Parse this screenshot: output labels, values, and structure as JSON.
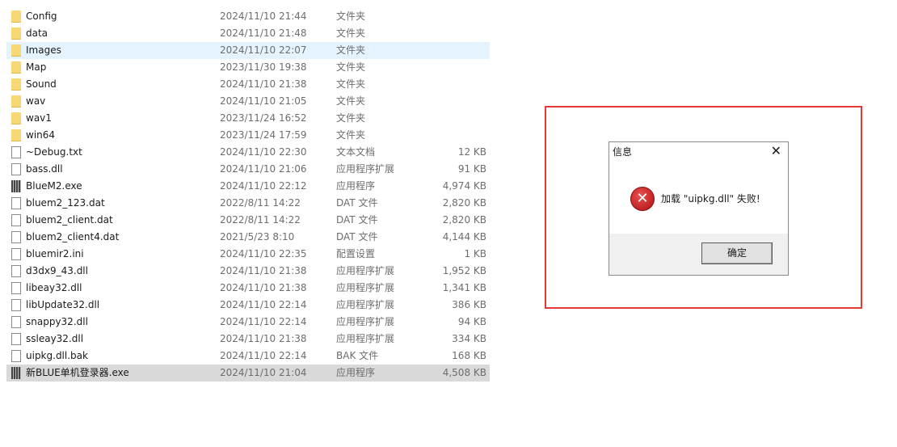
{
  "files": [
    {
      "name": "Config",
      "date": "2024/11/10 21:44",
      "type": "文件夹",
      "size": "",
      "icon": "folder-icon"
    },
    {
      "name": "data",
      "date": "2024/11/10 21:48",
      "type": "文件夹",
      "size": "",
      "icon": "folder-icon"
    },
    {
      "name": "Images",
      "date": "2024/11/10 22:07",
      "type": "文件夹",
      "size": "",
      "icon": "folder-icon",
      "state": "hover"
    },
    {
      "name": "Map",
      "date": "2023/11/30 19:38",
      "type": "文件夹",
      "size": "",
      "icon": "folder-icon"
    },
    {
      "name": "Sound",
      "date": "2024/11/10 21:38",
      "type": "文件夹",
      "size": "",
      "icon": "folder-icon"
    },
    {
      "name": "wav",
      "date": "2024/11/10 21:05",
      "type": "文件夹",
      "size": "",
      "icon": "folder-icon"
    },
    {
      "name": "wav1",
      "date": "2023/11/24 16:52",
      "type": "文件夹",
      "size": "",
      "icon": "folder-icon"
    },
    {
      "name": "win64",
      "date": "2023/11/24 17:59",
      "type": "文件夹",
      "size": "",
      "icon": "folder-icon"
    },
    {
      "name": "~Debug.txt",
      "date": "2024/11/10 22:30",
      "type": "文本文档",
      "size": "12 KB",
      "icon": "text-file-icon"
    },
    {
      "name": "bass.dll",
      "date": "2024/11/10 21:06",
      "type": "应用程序扩展",
      "size": "91 KB",
      "icon": "dll-file-icon"
    },
    {
      "name": "BlueM2.exe",
      "date": "2024/11/10 22:12",
      "type": "应用程序",
      "size": "4,974 KB",
      "icon": "exe-icon"
    },
    {
      "name": "bluem2_123.dat",
      "date": "2022/8/11 14:22",
      "type": "DAT 文件",
      "size": "2,820 KB",
      "icon": "file-icon"
    },
    {
      "name": "bluem2_client.dat",
      "date": "2022/8/11 14:22",
      "type": "DAT 文件",
      "size": "2,820 KB",
      "icon": "file-icon"
    },
    {
      "name": "bluem2_client4.dat",
      "date": "2021/5/23 8:10",
      "type": "DAT 文件",
      "size": "4,144 KB",
      "icon": "file-icon"
    },
    {
      "name": "bluemir2.ini",
      "date": "2024/11/10 22:35",
      "type": "配置设置",
      "size": "1 KB",
      "icon": "ini-file-icon"
    },
    {
      "name": "d3dx9_43.dll",
      "date": "2024/11/10 21:38",
      "type": "应用程序扩展",
      "size": "1,952 KB",
      "icon": "dll-file-icon"
    },
    {
      "name": "libeay32.dll",
      "date": "2024/11/10 21:38",
      "type": "应用程序扩展",
      "size": "1,341 KB",
      "icon": "dll-file-icon"
    },
    {
      "name": "libUpdate32.dll",
      "date": "2024/11/10 22:14",
      "type": "应用程序扩展",
      "size": "386 KB",
      "icon": "dll-file-icon"
    },
    {
      "name": "snappy32.dll",
      "date": "2024/11/10 22:14",
      "type": "应用程序扩展",
      "size": "94 KB",
      "icon": "dll-file-icon"
    },
    {
      "name": "ssleay32.dll",
      "date": "2024/11/10 21:38",
      "type": "应用程序扩展",
      "size": "334 KB",
      "icon": "dll-file-icon"
    },
    {
      "name": "uipkg.dll.bak",
      "date": "2024/11/10 22:14",
      "type": "BAK 文件",
      "size": "168 KB",
      "icon": "file-icon"
    },
    {
      "name": "新BLUE单机登录器.exe",
      "date": "2024/11/10 21:04",
      "type": "应用程序",
      "size": "4,508 KB",
      "icon": "exe-icon",
      "state": "selected"
    }
  ],
  "dialog": {
    "title": "信息",
    "close": "✕",
    "message": "加载 \"uipkg.dll\" 失败!",
    "ok_label": "确定",
    "icon": "error-icon"
  },
  "highlight_color": "#e53935"
}
